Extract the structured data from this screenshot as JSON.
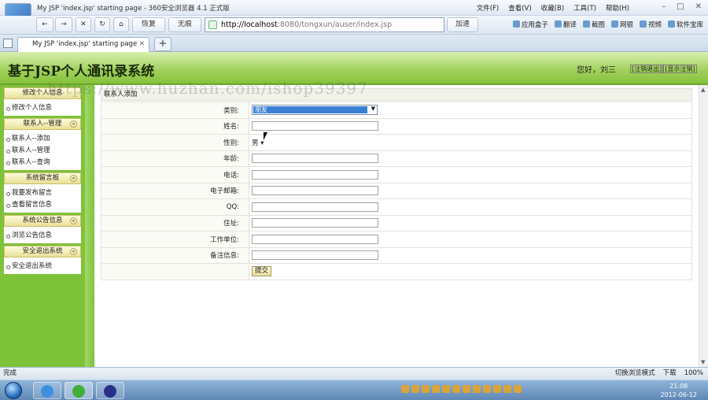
{
  "browser": {
    "app_title": "My JSP 'index.jsp' starting page - 360安全浏览器 4.1 正式版",
    "menu": [
      "文件(F)",
      "查看(V)",
      "收藏(B)",
      "工具(T)",
      "帮助(H)"
    ],
    "back_label": "←",
    "forward_label": "→",
    "stop_label": "✕",
    "refresh_label": "↻",
    "home_label": "⌂",
    "restore_label": "恢复",
    "notrace_label": "无痕",
    "address_host": "http://localhost",
    "address_path": ":8080/tongxun/auser/index.jsp",
    "accel_label": "加速",
    "tools": [
      "应用盒子",
      "翻译",
      "截图",
      "网银",
      "视频",
      "软件宝库"
    ],
    "tab_title": "My JSP 'index.jsp' starting page",
    "new_tab_label": "+",
    "status_left": "完成",
    "status_right": [
      "切换浏览模式",
      "下载",
      "100%"
    ],
    "clock_time": "21:08",
    "clock_date": "2012-06-12"
  },
  "header": {
    "site_title": "基于JSP个人通讯录系统",
    "greeting": "您好，刘三",
    "logout_label": "[注销退出]",
    "show_logout_label": "[显示注销]",
    "watermark": "https://www.huzhan.com/ishop39397"
  },
  "sidebar": {
    "groups": [
      {
        "title": "修改个人信息",
        "items": [
          "修改个人信息"
        ]
      },
      {
        "title": "联系人--管理",
        "items": [
          "联系人--添加",
          "联系人--管理",
          "联系人--查询"
        ]
      },
      {
        "title": "系统留言板",
        "items": [
          "我要发布留言",
          "查看留言信息"
        ]
      },
      {
        "title": "系统公告信息",
        "items": [
          "浏览公告信息"
        ]
      },
      {
        "title": "安全退出系统",
        "items": [
          "安全退出系统"
        ]
      }
    ],
    "toggle_glyph": "«"
  },
  "form": {
    "title": "联系人添加",
    "category_label": "类别:",
    "category_value": "朋友",
    "name_label": "姓名:",
    "gender_label": "性别:",
    "gender_value": "男",
    "age_label": "年龄:",
    "phone_label": "电话:",
    "email_label": "电子邮箱:",
    "qq_label": "QQ:",
    "address_label": "住址:",
    "work_label": "工作单位:",
    "note_label": "备注信息:",
    "submit_label": "提交"
  }
}
